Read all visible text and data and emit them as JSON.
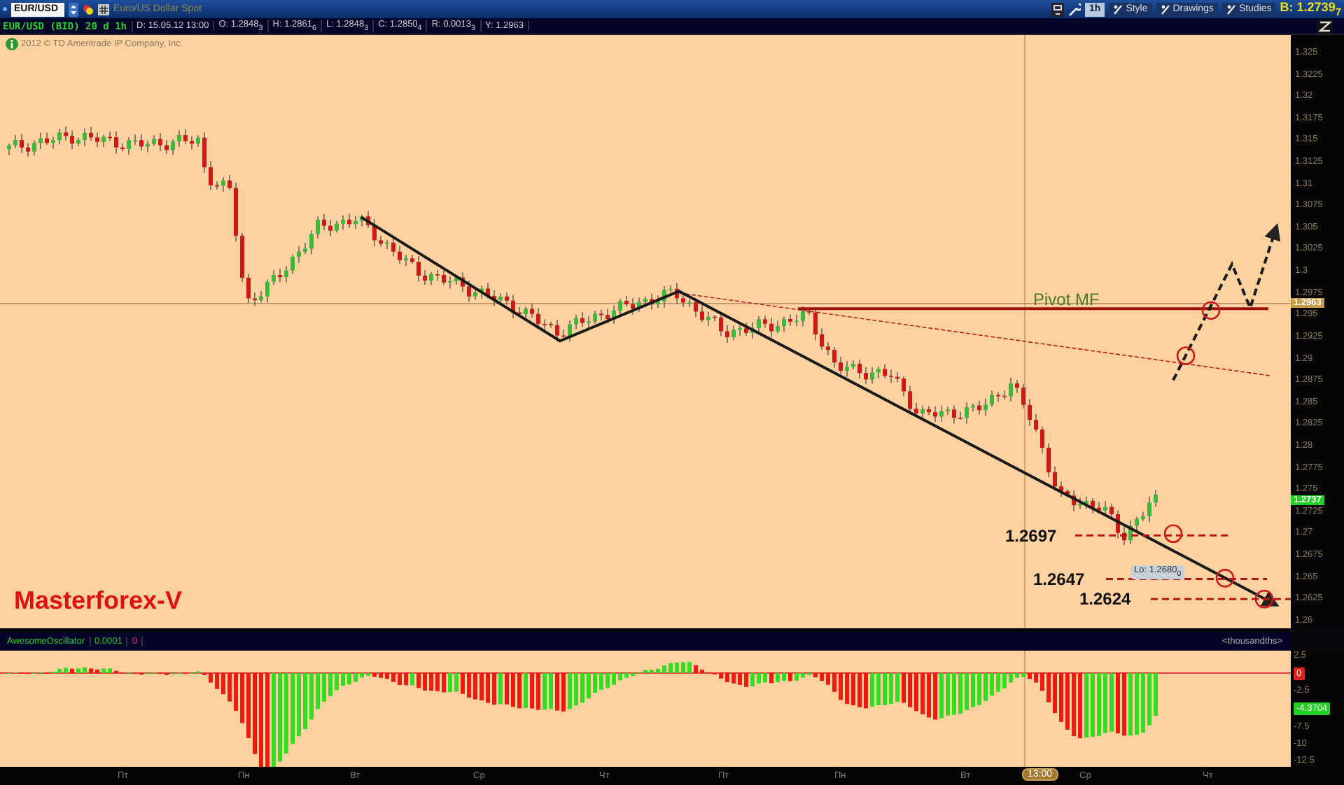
{
  "toolbar": {
    "symbol": "EUR/USD",
    "description": "Euro/US Dollar Spot",
    "interval": "1h",
    "buttons": [
      "Style",
      "Drawings",
      "Studies"
    ],
    "bid": "B: 1.2739$_{7}$"
  },
  "info_bar": {
    "title": "EUR/USD (BID) 20 d 1h",
    "cells": [
      "D: 15.05.12 13:00",
      "O: 1.2848$_{3}$",
      "H: 1.2861$_{6}$",
      "L: 1.2848$_{3}$",
      "C: 1.2850$_{4}$",
      "R: 0.0013$_{3}$",
      "Y: 1.2963"
    ]
  },
  "copyright": "2012 © TD Ameritrade IP Company, Inc.",
  "watermark_label": "Masterforex-V",
  "annotations": {
    "pivot": "Pivot MF",
    "levels": [
      "1.2697",
      "1.2647",
      "1.2624"
    ],
    "low": "Lo: 1.2680$_{0}$"
  },
  "price_axis": [
    "1.325",
    "1.3225",
    "1.32",
    "1.3175",
    "1.315",
    "1.3125",
    "1.31",
    "1.3075",
    "1.305",
    "1.3025",
    "1.3",
    "1.2975",
    "1.295",
    "1.2925",
    "1.29",
    "1.2875",
    "1.285",
    "1.2825",
    "1.28",
    "1.2775",
    "1.275",
    "1.2725",
    "1.27",
    "1.2675",
    "1.265",
    "1.2625",
    "1.26"
  ],
  "price_badges": [
    {
      "text": "1.2963",
      "color": "#c89a48"
    },
    {
      "text": "1.2737",
      "color": "#22d022"
    }
  ],
  "oscillator": {
    "name": "AwesomeOscillator",
    "value": "0.0001",
    "zero": "0",
    "units": "<thousandths>"
  },
  "osc_axis": [
    {
      "kind": "tick",
      "text": "2.5"
    },
    {
      "kind": "badge",
      "text": "0",
      "color": "#e0201a"
    },
    {
      "kind": "tick",
      "text": "-2.5"
    },
    {
      "kind": "badge",
      "text": "-4.3704",
      "color": "#22d022"
    },
    {
      "kind": "tick",
      "text": "-7.5"
    },
    {
      "kind": "tick",
      "text": "-10"
    },
    {
      "kind": "tick",
      "text": "-12.5"
    }
  ],
  "time_axis": [
    {
      "kind": "tick",
      "text": "Пт"
    },
    {
      "kind": "tick",
      "text": "Пн"
    },
    {
      "kind": "tick",
      "text": "Вт"
    },
    {
      "kind": "tick",
      "text": "Ср"
    },
    {
      "kind": "tick",
      "text": "Чт"
    },
    {
      "kind": "tick",
      "text": "Пт"
    },
    {
      "kind": "tick",
      "text": "Пн"
    },
    {
      "kind": "tick",
      "text": "Вт"
    },
    {
      "kind": "badge",
      "text": "13:00"
    },
    {
      "kind": "tick",
      "text": "Ср"
    },
    {
      "kind": "tick",
      "text": "Чт"
    }
  ]
}
